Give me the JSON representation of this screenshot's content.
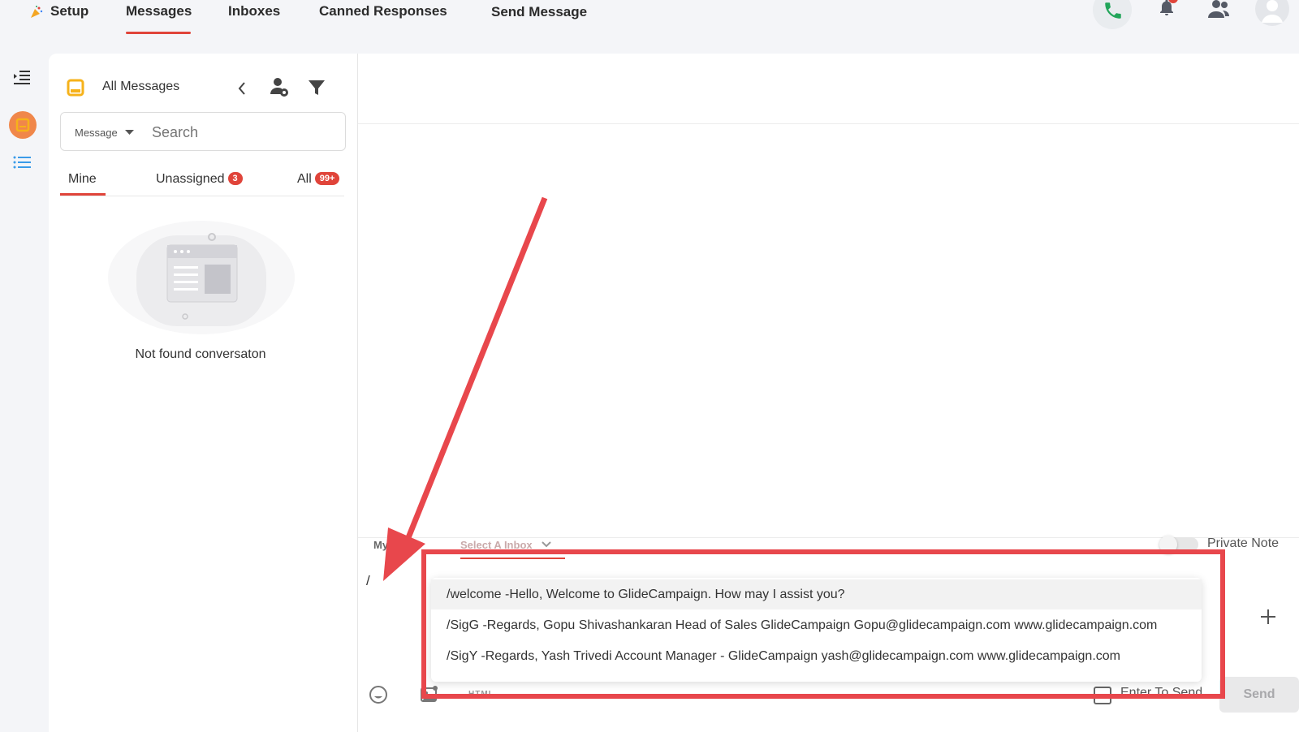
{
  "nav": {
    "setup": "Setup",
    "messages": "Messages",
    "inboxes": "Inboxes",
    "canned_responses": "Canned Responses",
    "send_message": "Send Message"
  },
  "colors": {
    "accent": "#e0443a",
    "phone_green": "#22a55a",
    "inbox_yellow": "#f6b21a",
    "orange_circle": "#f0874a",
    "annotation_red": "#e8474c"
  },
  "sidebar": {
    "title": "All Messages",
    "search": {
      "filter_label": "Message",
      "placeholder": "Search"
    },
    "tabs": [
      {
        "label": "Mine"
      },
      {
        "label": "Unassigned",
        "badge": "3"
      },
      {
        "label": "All",
        "badge": "99+"
      }
    ],
    "empty_text": "Not found conversaton"
  },
  "composer": {
    "from_label": "My Email",
    "inbox_select": "Select A Inbox",
    "private_note": "Private Note",
    "input_value": "/",
    "html_label": "HTML",
    "enter_to_send": "Enter To Send",
    "send_label": "Send"
  },
  "canned_suggestions": [
    "/welcome -Hello, Welcome to GlideCampaign. How may I assist you?",
    "/SigG -Regards, Gopu Shivashankaran Head of Sales GlideCampaign Gopu@glidecampaign.com www.glidecampaign.com",
    "/SigY -Regards, Yash Trivedi Account Manager - GlideCampaign yash@glidecampaign.com www.glidecampaign.com"
  ]
}
